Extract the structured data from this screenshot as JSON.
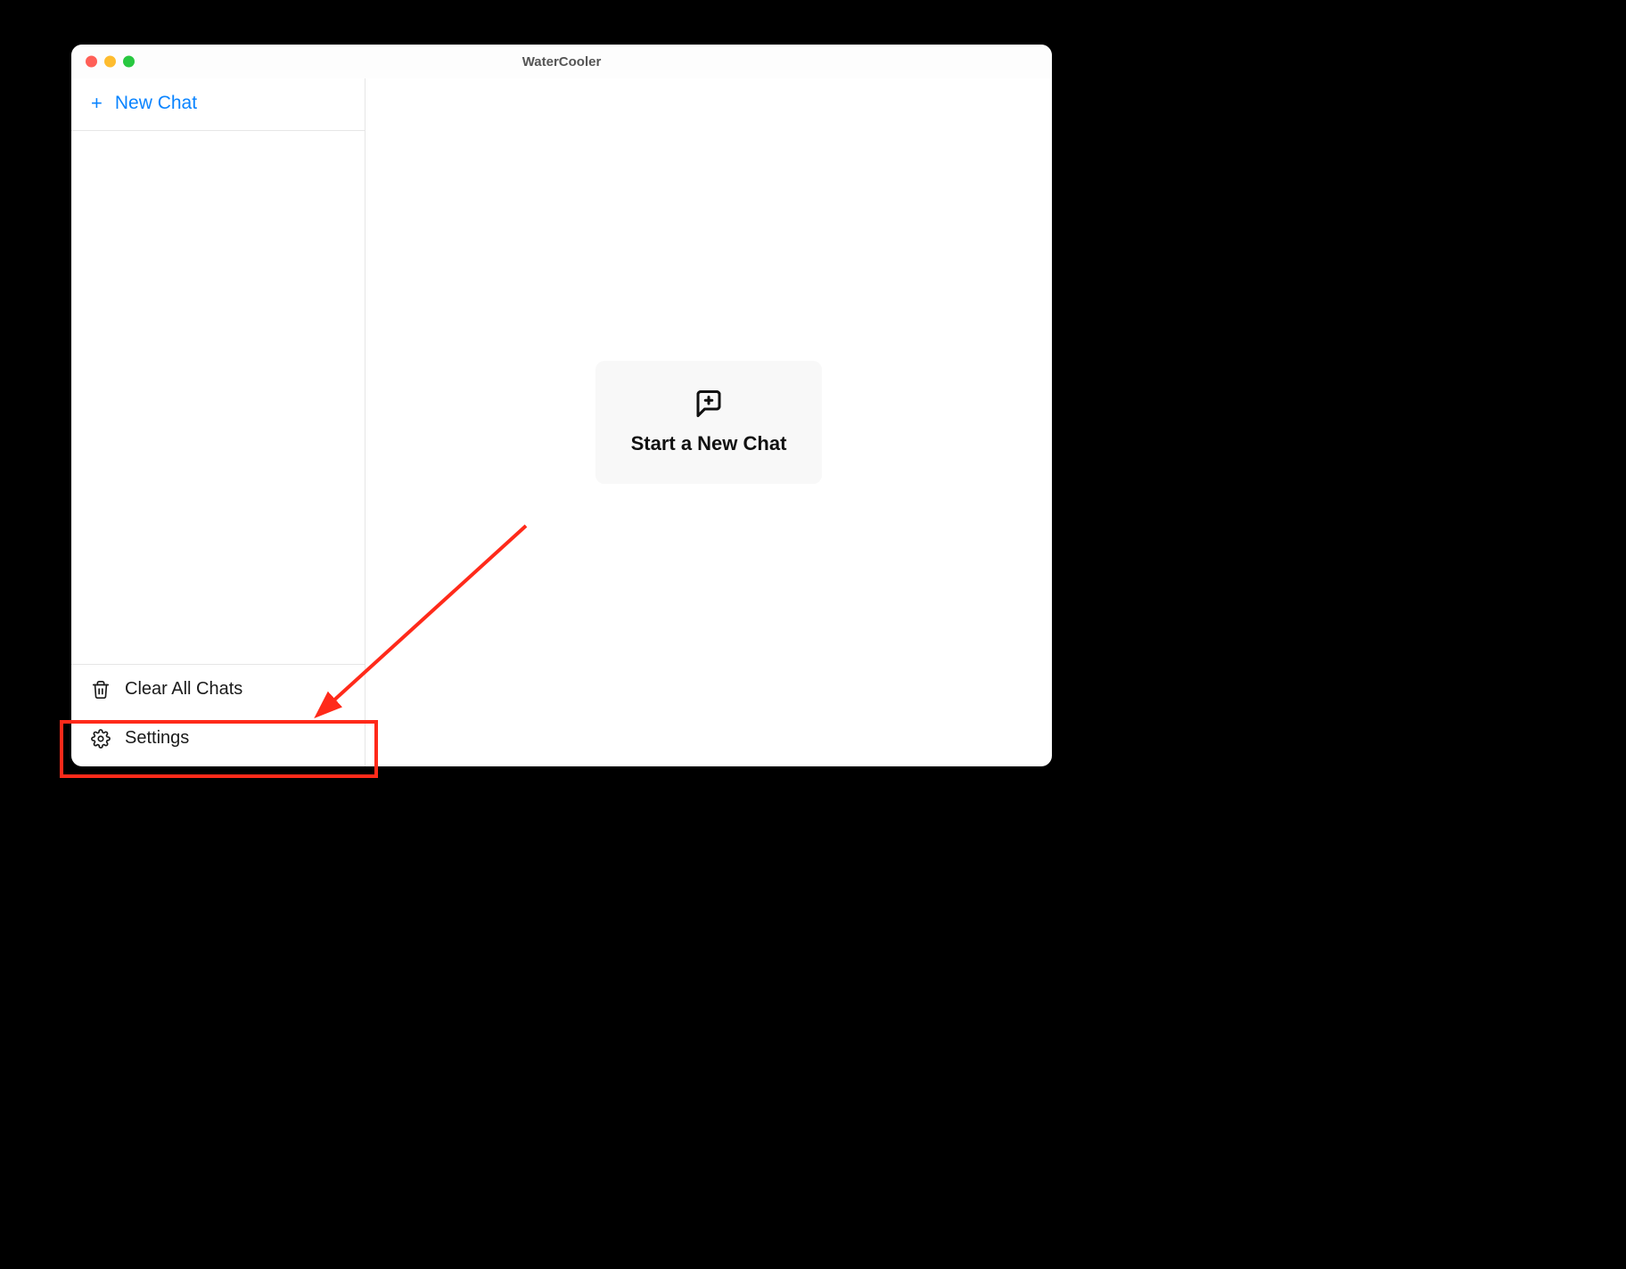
{
  "window": {
    "title": "WaterCooler"
  },
  "sidebar": {
    "new_chat_label": "New Chat",
    "clear_all_label": "Clear All Chats",
    "settings_label": "Settings"
  },
  "main": {
    "start_new_chat_label": "Start a New Chat"
  },
  "annotation": {
    "highlight_color": "#ff2a1a"
  }
}
